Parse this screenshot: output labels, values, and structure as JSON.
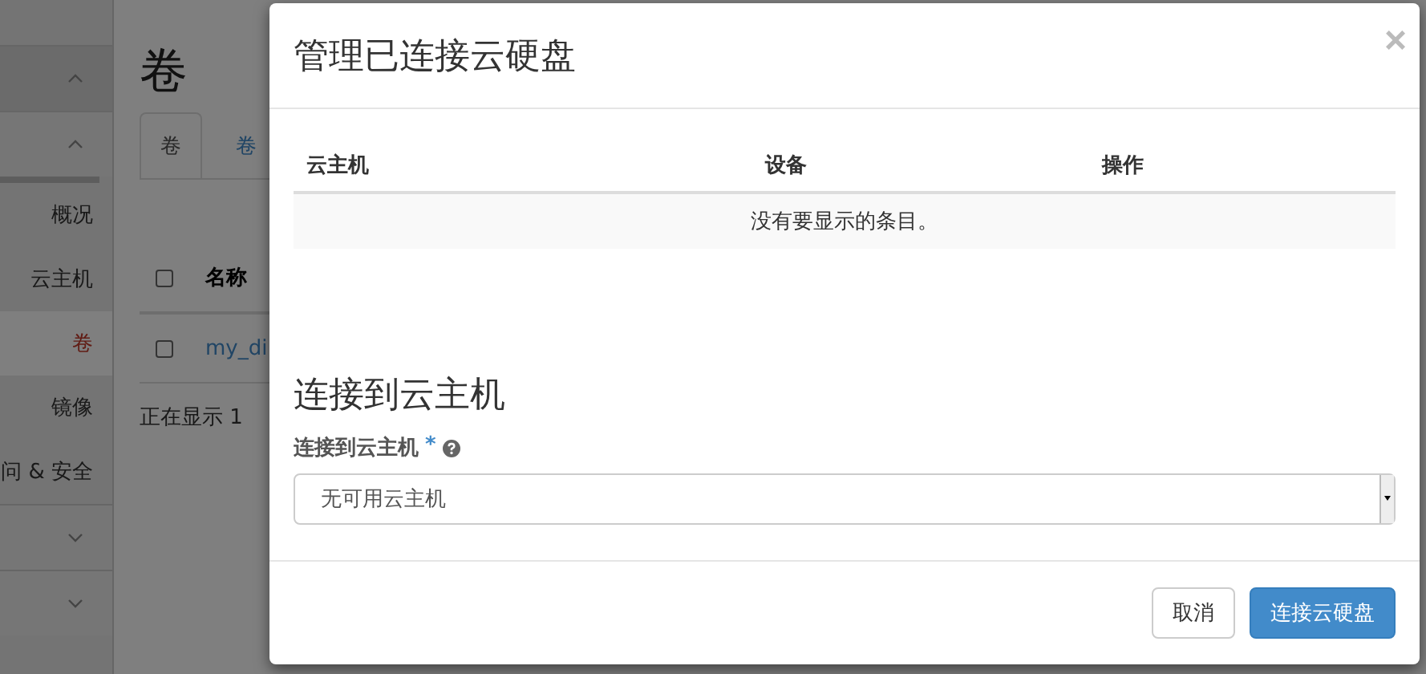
{
  "sidebar": {
    "panels": [
      {
        "expanded": true
      },
      {
        "expanded": true,
        "items": [
          {
            "label": "概况",
            "selected": false
          },
          {
            "label": "云主机",
            "selected": false
          },
          {
            "label": "卷",
            "selected": true
          },
          {
            "label": "镜像",
            "selected": false
          },
          {
            "label": "问 & 安全",
            "selected": false
          }
        ]
      },
      {
        "expanded": false
      },
      {
        "expanded": false
      }
    ]
  },
  "page": {
    "title": "卷",
    "tabs": [
      {
        "label": "卷",
        "selected": true
      },
      {
        "label": "卷",
        "selected": false
      }
    ],
    "table": {
      "columns": [
        "名称"
      ],
      "all_checked": false,
      "rows": [
        {
          "checked": false,
          "name": "my_di"
        }
      ]
    },
    "footer": "正在显示 1"
  },
  "modal": {
    "title": "管理已连接云硬盘",
    "close": "×",
    "table": {
      "columns": [
        "云主机",
        "设备",
        "操作"
      ],
      "empty": "没有要显示的条目。"
    },
    "section_title": "连接到云主机",
    "field": {
      "label": "连接到云主机",
      "required": "*",
      "value": "无可用云主机"
    },
    "buttons": [
      {
        "label": "取消",
        "kind": "default"
      },
      {
        "label": "连接云硬盘",
        "kind": "primary"
      }
    ]
  }
}
